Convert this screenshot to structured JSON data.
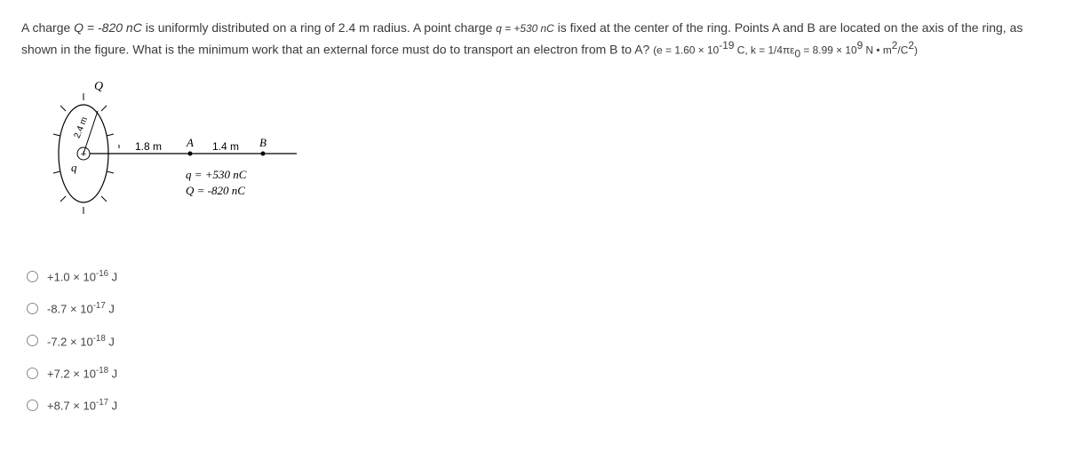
{
  "question": {
    "line1_pre": "A charge ",
    "line1_q_eq": "Q = -820 nC",
    "line1_mid1": " is uniformly distributed on a ring of 2.4 m radius. A point charge ",
    "line1_qval": "q = +530 nC",
    "line1_mid2": " is fixed at the center of the ring. Points A and B are located on the axis of the ring, as",
    "line2_pre": "shown in the figure. What is the minimum work that an external force must do to transport an electron from B to A? ",
    "line2_paren_pre": "(e = 1.60 × 10",
    "line2_exp1": "-19",
    "line2_paren_mid1": " C, k = 1/4πε",
    "line2_sub0": "0",
    "line2_paren_mid2": " = 8.99 × 10",
    "line2_exp2": "9",
    "line2_paren_end": " N • m",
    "line2_exp3": "2",
    "line2_sl": "/C",
    "line2_exp4": "2",
    "line2_close": ")"
  },
  "figure": {
    "Qlabel": "Q",
    "qlabel": "q",
    "radius_label": "2.4 m",
    "dist1": "1.8 m",
    "Alabel": "A",
    "dist2": "1.4 m",
    "Blabel": "B",
    "eq1": "q = +530 nC",
    "eq2": "Q = -820 nC"
  },
  "options": [
    {
      "pre": "+1.0 × 10",
      "exp": "-16",
      "unit": " J"
    },
    {
      "pre": "-8.7 × 10",
      "exp": "-17",
      "unit": " J"
    },
    {
      "pre": "-7.2 × 10",
      "exp": "-18",
      "unit": " J"
    },
    {
      "pre": "+7.2 × 10",
      "exp": "-18",
      "unit": " J"
    },
    {
      "pre": "+8.7 × 10",
      "exp": "-17",
      "unit": " J"
    }
  ]
}
